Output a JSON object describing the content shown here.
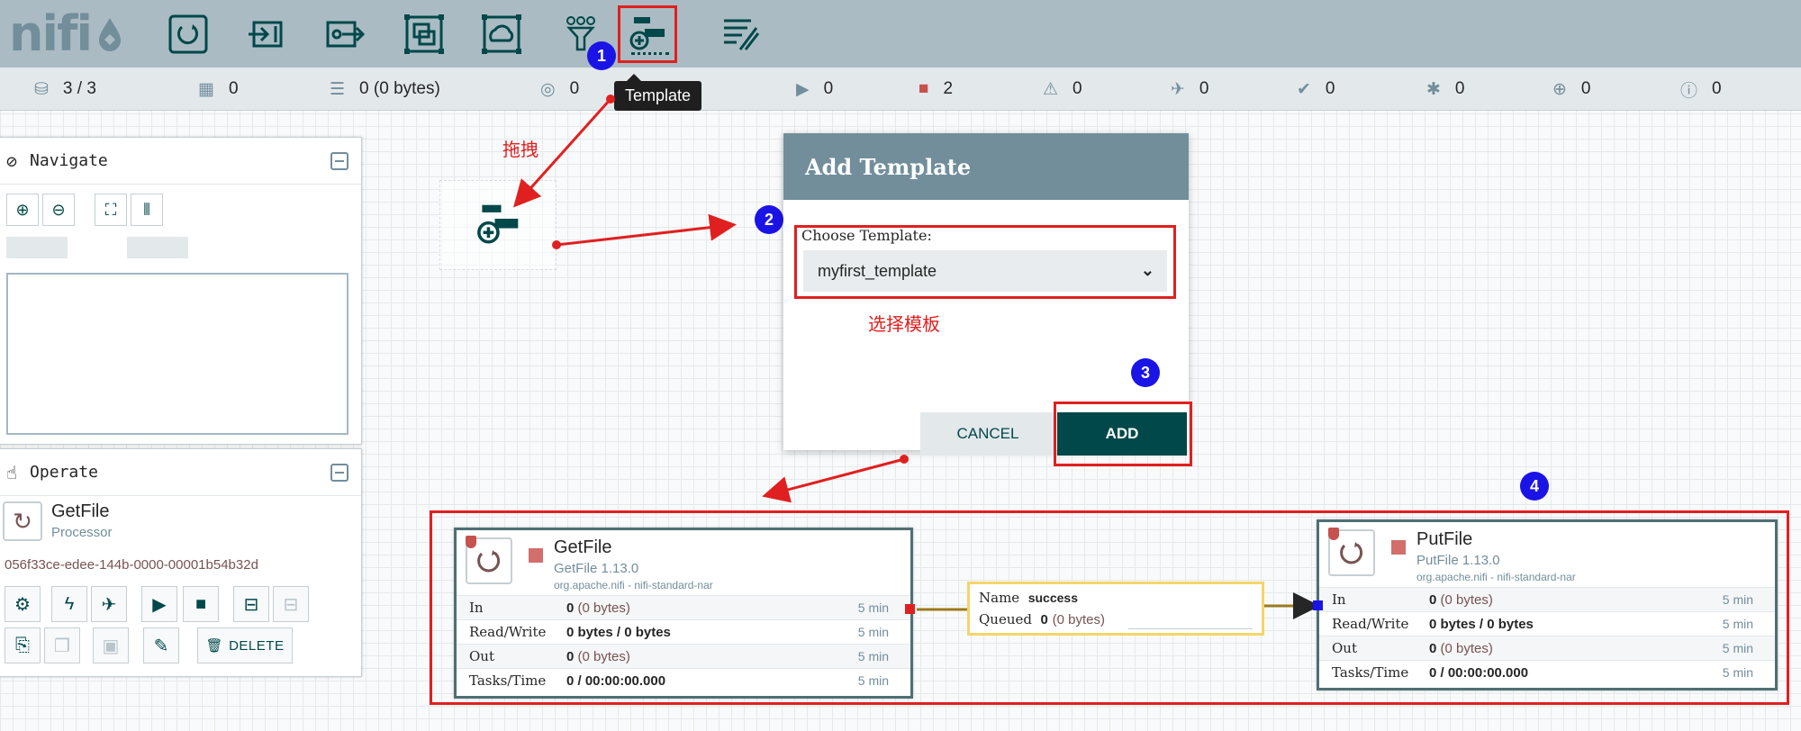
{
  "app": {
    "logo_text": "nifi"
  },
  "toolbar": {
    "items": [
      {
        "name": "processor",
        "icon": "processor-icon"
      },
      {
        "name": "input-port",
        "icon": "input-port-icon"
      },
      {
        "name": "output-port",
        "icon": "output-port-icon"
      },
      {
        "name": "process-group",
        "icon": "process-group-icon"
      },
      {
        "name": "remote-process-group",
        "icon": "remote-process-group-icon"
      },
      {
        "name": "funnel",
        "icon": "funnel-icon"
      },
      {
        "name": "template",
        "icon": "template-icon"
      },
      {
        "name": "label",
        "icon": "label-icon"
      }
    ],
    "tooltip": "Template"
  },
  "status": {
    "cluster": "3 / 3",
    "threads": "0",
    "queued": "0 (0 bytes)",
    "transmitting": "0",
    "running": "0",
    "stopped": "2",
    "invalid": "0",
    "disabled": "0",
    "up_to_date": "0",
    "locally_modified": "0",
    "stale": "0",
    "errors": "0"
  },
  "annotations": {
    "badge1": "1",
    "badge2": "2",
    "badge3": "3",
    "badge4": "4",
    "drag_text": "拖拽",
    "choose_note": "选择模板"
  },
  "navigate": {
    "title": "Navigate"
  },
  "operate": {
    "title": "Operate",
    "component_name": "GetFile",
    "component_type": "Processor",
    "component_id": "056f33ce-edee-144b-0000-00001b54b32d",
    "delete_label": "DELETE"
  },
  "dialog": {
    "title": "Add Template",
    "choose_label": "Choose Template:",
    "selected": "myfirst_template",
    "cancel": "CANCEL",
    "add": "ADD"
  },
  "processors": {
    "get": {
      "name": "GetFile",
      "type": "GetFile 1.13.0",
      "bundle": "org.apache.nifi - nifi-standard-nar",
      "in_count": "0",
      "in_bytes": "(0 bytes)",
      "rw": "0 bytes / 0 bytes",
      "out_count": "0",
      "out_bytes": "(0 bytes)",
      "tasks": "0 / 00:00:00.000"
    },
    "put": {
      "name": "PutFile",
      "type": "PutFile 1.13.0",
      "bundle": "org.apache.nifi - nifi-standard-nar",
      "in_count": "0",
      "in_bytes": "(0 bytes)",
      "rw": "0 bytes / 0 bytes",
      "out_count": "0",
      "out_bytes": "(0 bytes)",
      "tasks": "0 / 00:00:00.000"
    },
    "labels": {
      "in": "In",
      "rw": "Read/Write",
      "out": "Out",
      "tasks": "Tasks/Time",
      "window": "5 min"
    }
  },
  "connection": {
    "name_label": "Name",
    "name_value": "success",
    "queued_label": "Queued",
    "queued_count": "0",
    "queued_bytes": "(0 bytes)"
  },
  "colors": {
    "toolbar": "#aabbc3",
    "accent": "#004849",
    "annotation_red": "#e02020",
    "badge_blue": "#1b14e6",
    "processor_border": "#4f6f73",
    "connection_border": "#f5d56a"
  }
}
